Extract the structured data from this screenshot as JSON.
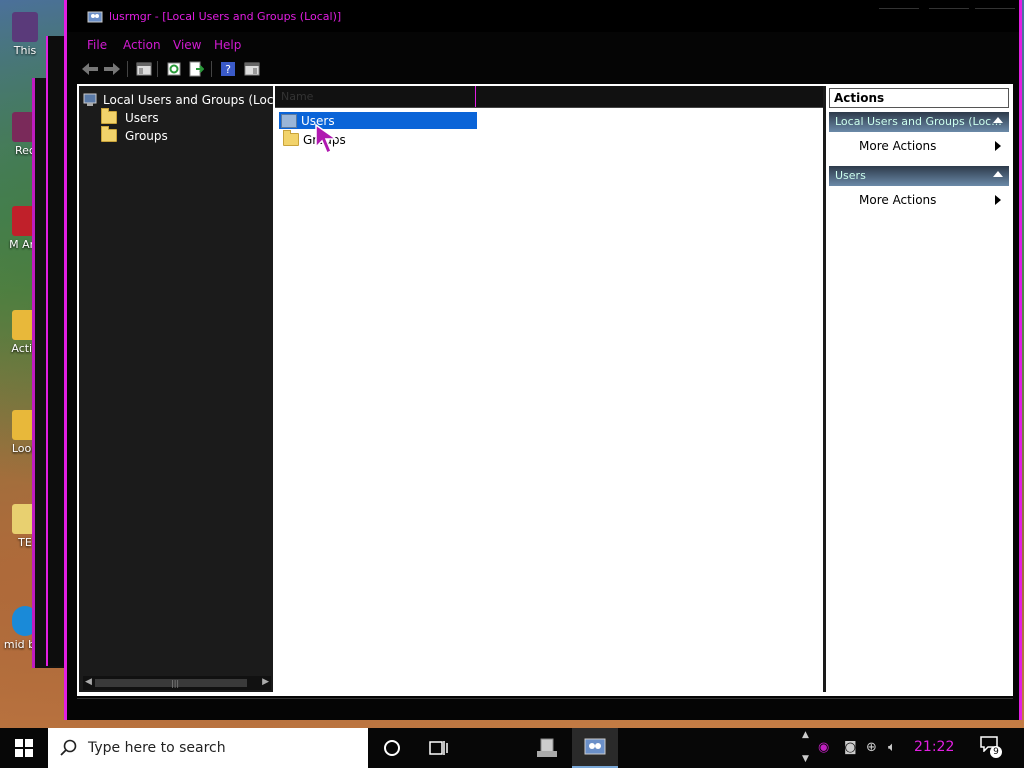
{
  "desktop": {
    "icons": [
      {
        "label": "This",
        "color": "#5a3a7a"
      },
      {
        "label": "Rec",
        "color": "#7a2a5a"
      },
      {
        "label": "M Ant",
        "color": "#c0202a"
      },
      {
        "label": "Activ",
        "color": "#e8b83a"
      },
      {
        "label": "Loon",
        "color": "#e8b83a"
      },
      {
        "label": "TE",
        "color": "#e8d070"
      },
      {
        "label": "mid bro",
        "color": "#1a8ad8"
      }
    ]
  },
  "window": {
    "title": "lusrmgr - [Local Users and Groups (Local)]",
    "menu": [
      "File",
      "Action",
      "View",
      "Help"
    ],
    "toolbar_icons": [
      "back-arrow-icon",
      "forward-arrow-icon",
      "show-hide-console-tree-icon",
      "refresh-icon",
      "export-list-icon",
      "help-icon",
      "show-hide-action-pane-icon"
    ]
  },
  "tree": {
    "root": "Local Users and Groups (Local)",
    "children": [
      "Users",
      "Groups"
    ]
  },
  "list": {
    "column": "Name",
    "items": [
      {
        "label": "Users",
        "selected": true
      },
      {
        "label": "Groups",
        "selected": false
      }
    ]
  },
  "actions": {
    "header": "Actions",
    "sections": [
      {
        "title": "Local Users and Groups (Loc...",
        "item": "More Actions"
      },
      {
        "title": "Users",
        "item": "More Actions"
      }
    ]
  },
  "taskbar": {
    "search_placeholder": "Type here to search",
    "clock": "21:22",
    "notification_count": "9",
    "accent": "#e21ee2"
  }
}
